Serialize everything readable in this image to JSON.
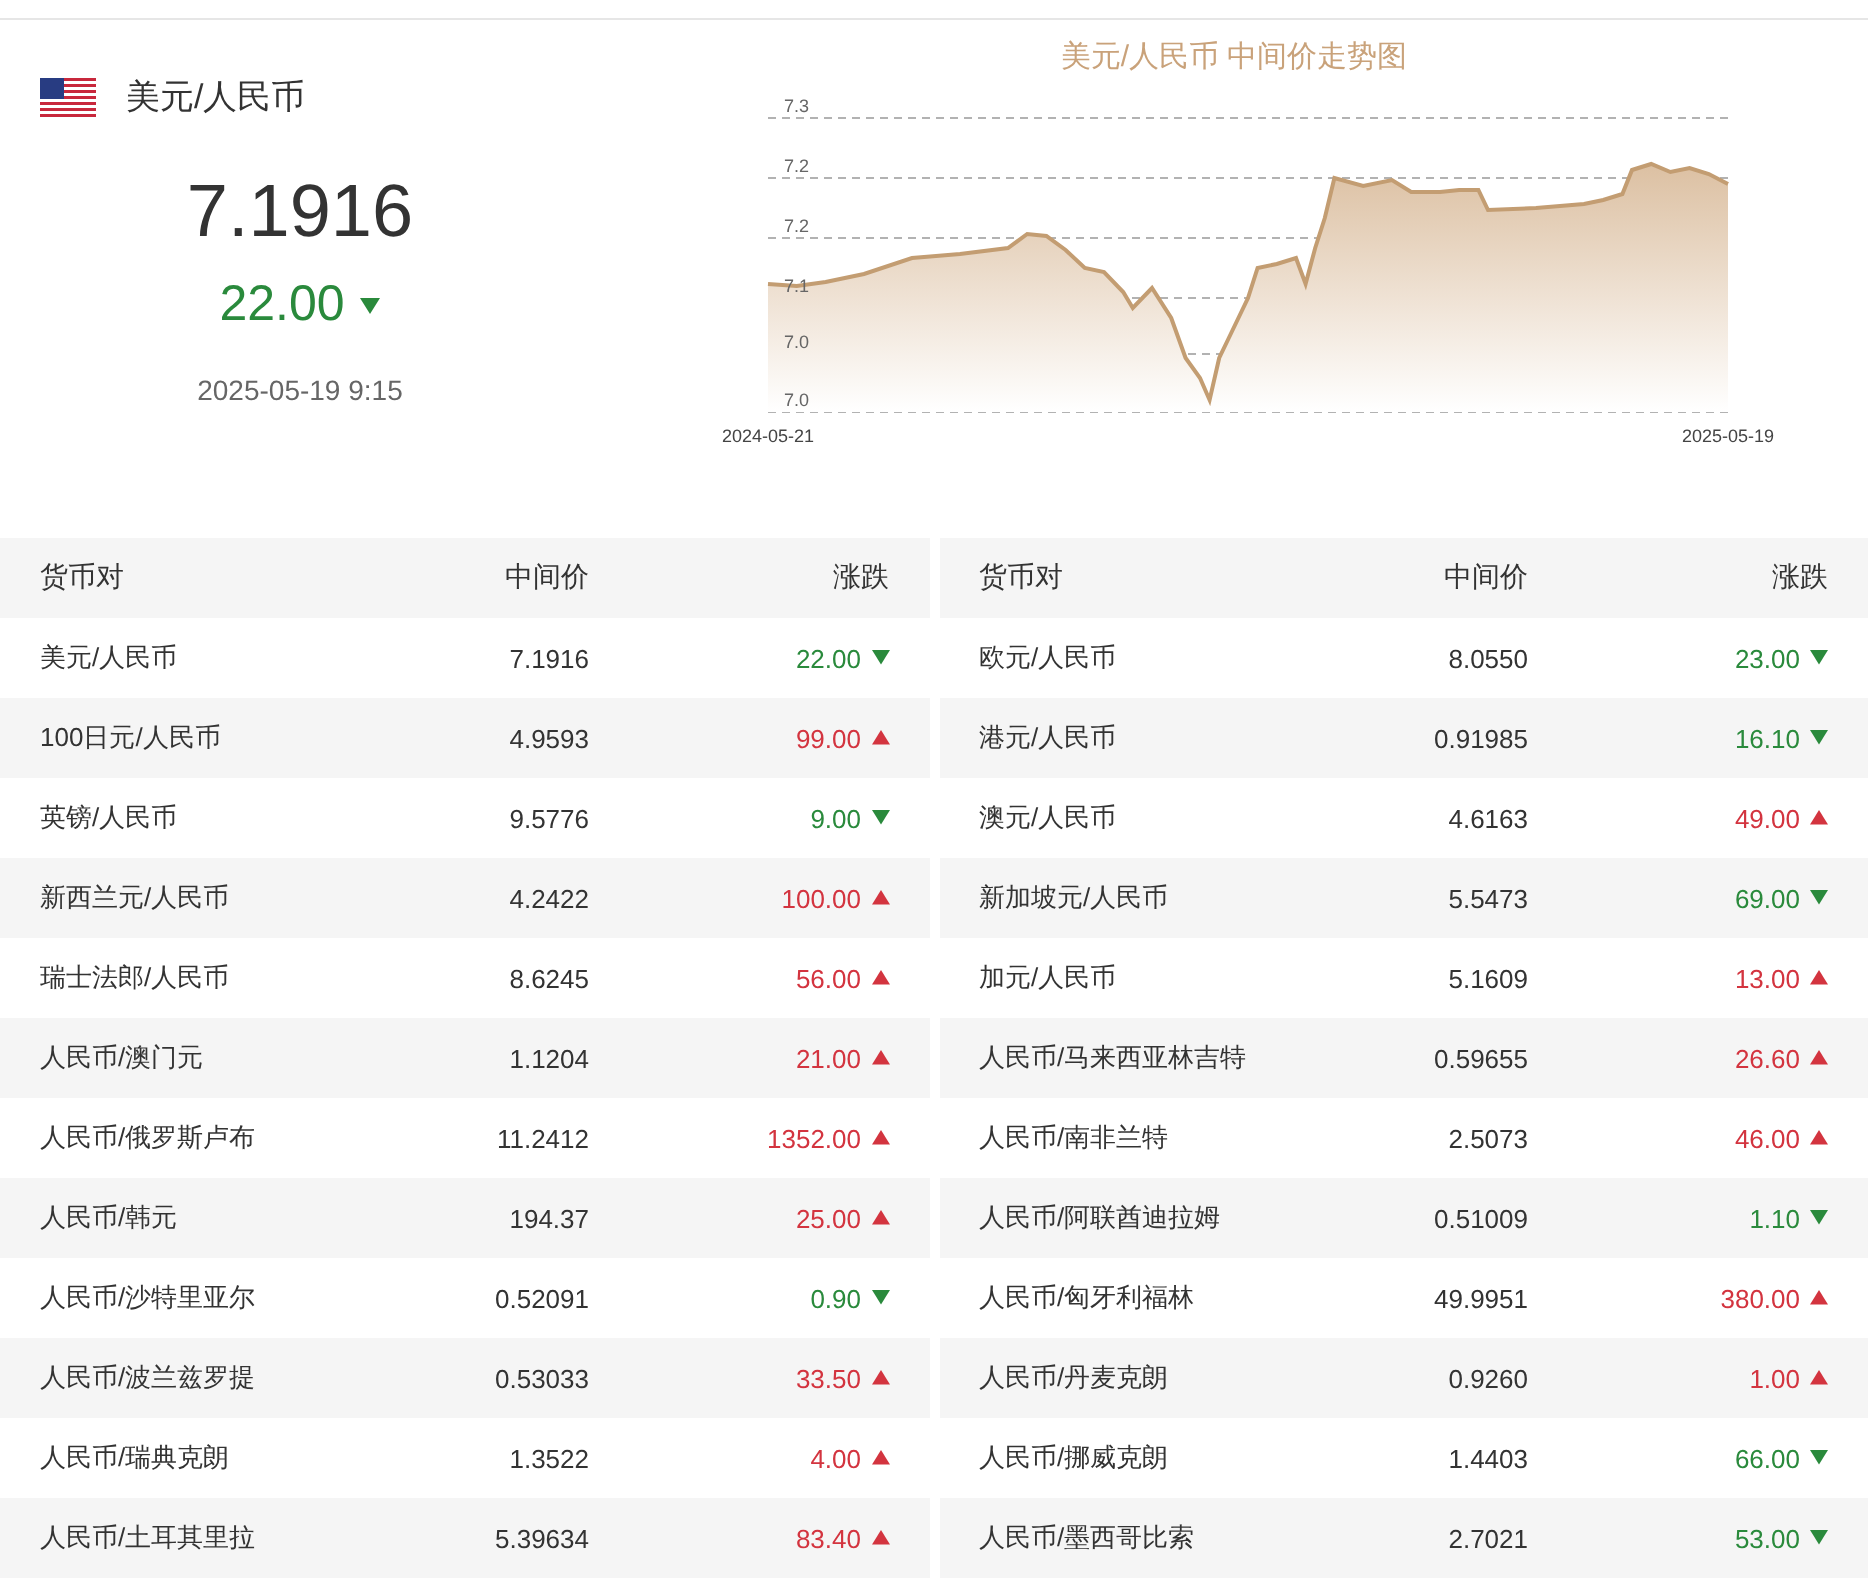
{
  "summary": {
    "pair": "美元/人民币",
    "price": "7.1916",
    "change": "22.00",
    "rising": false,
    "time": "2025-05-19 9:15"
  },
  "chart": {
    "title": "美元/人民币 中间价走势图",
    "y_labels": [
      "7.3",
      "7.2",
      "7.2",
      "7.1",
      "7.0",
      "7.0"
    ],
    "x_labels": [
      "2024-05-21",
      "2025-05-19"
    ]
  },
  "tables": [
    {
      "columns": [
        "货币对",
        "中间价",
        "涨跌"
      ],
      "rows": [
        {
          "pair": "美元/人民币",
          "price": "7.1916",
          "change": "22.00",
          "rising": false
        },
        {
          "pair": "100日元/人民币",
          "price": "4.9593",
          "change": "99.00",
          "rising": true
        },
        {
          "pair": "英镑/人民币",
          "price": "9.5776",
          "change": "9.00",
          "rising": false
        },
        {
          "pair": "新西兰元/人民币",
          "price": "4.2422",
          "change": "100.00",
          "rising": true
        },
        {
          "pair": "瑞士法郎/人民币",
          "price": "8.6245",
          "change": "56.00",
          "rising": true
        },
        {
          "pair": "人民币/澳门元",
          "price": "1.1204",
          "change": "21.00",
          "rising": true
        },
        {
          "pair": "人民币/俄罗斯卢布",
          "price": "11.2412",
          "change": "1352.00",
          "rising": true
        },
        {
          "pair": "人民币/韩元",
          "price": "194.37",
          "change": "25.00",
          "rising": true
        },
        {
          "pair": "人民币/沙特里亚尔",
          "price": "0.52091",
          "change": "0.90",
          "rising": false
        },
        {
          "pair": "人民币/波兰兹罗提",
          "price": "0.53033",
          "change": "33.50",
          "rising": true
        },
        {
          "pair": "人民币/瑞典克朗",
          "price": "1.3522",
          "change": "4.00",
          "rising": true
        },
        {
          "pair": "人民币/土耳其里拉",
          "price": "5.39634",
          "change": "83.40",
          "rising": true
        }
      ]
    },
    {
      "columns": [
        "货币对",
        "中间价",
        "涨跌"
      ],
      "rows": [
        {
          "pair": "欧元/人民币",
          "price": "8.0550",
          "change": "23.00",
          "rising": false
        },
        {
          "pair": "港元/人民币",
          "price": "0.91985",
          "change": "16.10",
          "rising": false
        },
        {
          "pair": "澳元/人民币",
          "price": "4.6163",
          "change": "49.00",
          "rising": true
        },
        {
          "pair": "新加坡元/人民币",
          "price": "5.5473",
          "change": "69.00",
          "rising": false
        },
        {
          "pair": "加元/人民币",
          "price": "5.1609",
          "change": "13.00",
          "rising": true
        },
        {
          "pair": "人民币/马来西亚林吉特",
          "price": "0.59655",
          "change": "26.60",
          "rising": true
        },
        {
          "pair": "人民币/南非兰特",
          "price": "2.5073",
          "change": "46.00",
          "rising": true
        },
        {
          "pair": "人民币/阿联酋迪拉姆",
          "price": "0.51009",
          "change": "1.10",
          "rising": false
        },
        {
          "pair": "人民币/匈牙利福林",
          "price": "49.9951",
          "change": "380.00",
          "rising": true
        },
        {
          "pair": "人民币/丹麦克朗",
          "price": "0.9260",
          "change": "1.00",
          "rising": true
        },
        {
          "pair": "人民币/挪威克朗",
          "price": "1.4403",
          "change": "66.00",
          "rising": false
        },
        {
          "pair": "人民币/墨西哥比索",
          "price": "2.7021",
          "change": "53.00",
          "rising": false
        }
      ]
    }
  ]
}
